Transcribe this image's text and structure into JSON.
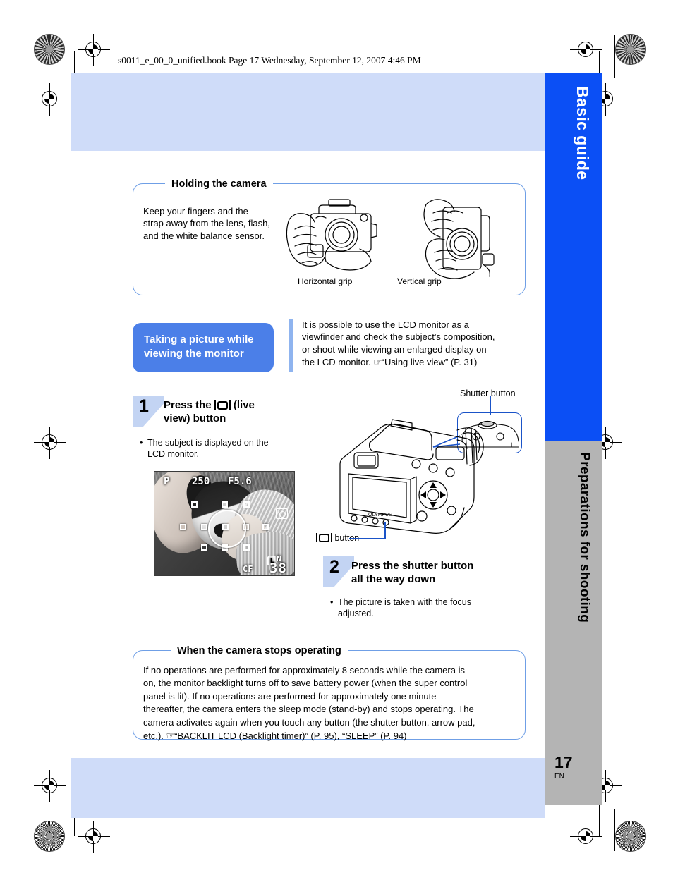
{
  "header": {
    "book_line": "s0011_e_00_0_unified.book  Page 17  Wednesday, September 12, 2007  4:46 PM"
  },
  "side_tabs": [
    {
      "label": "Basic guide",
      "color": "#0b4ff5",
      "text_color": "#ffffff"
    },
    {
      "label": "Preparations for shooting",
      "color": "#b4b4b4",
      "text_color": "#000000"
    }
  ],
  "page_footer": {
    "number": "17",
    "language": "EN"
  },
  "holding_panel": {
    "title": "Holding the camera",
    "body": "Keep your fingers and the strap away from the lens, flash, and the white balance sensor.",
    "caption_left": "Horizontal grip",
    "caption_right": "Vertical grip"
  },
  "section": {
    "callout_title": "Taking a picture while viewing the monitor",
    "intro_line1": "It is possible to use the LCD monitor as a",
    "intro_line2": "viewfinder and check the subject's composition,",
    "intro_line3": "or shoot while viewing an enlarged display on",
    "intro_line4_prefix": "the LCD monitor. ",
    "intro_line4_ref": "“Using live view” (P. 31)"
  },
  "steps": [
    {
      "number": "1",
      "title_line1_before": "Press the ",
      "title_line1_after": " (live",
      "title_line2": "view) button",
      "bullet_marker": "•",
      "bullet_line1": "The subject is displayed on the",
      "bullet_line2": "LCD monitor."
    },
    {
      "number": "2",
      "title_line1": "Press the shutter button",
      "title_line2": "all the way down",
      "bullet_marker": "•",
      "bullet_line1": "The picture is taken with the focus",
      "bullet_line2": "adjusted."
    }
  ],
  "lcd_display": {
    "mode": "P",
    "shutter_speed": "250",
    "aperture": "F5.6",
    "quality_size": "L",
    "quality_compression": "N",
    "card": "CF",
    "frames_remaining": "38",
    "metering_icon": "esp-metering-icon"
  },
  "camera_labels": {
    "shutter_button": "Shutter button",
    "live_view_button_suffix": " button"
  },
  "stops_panel": {
    "title": "When the camera stops operating",
    "line1": "If no operations are performed for approximately 8 seconds while the camera is",
    "line2": "on, the monitor backlight turns off to save battery power (when the super control",
    "line3": "panel is lit). If no operations are performed for approximately one minute",
    "line4": "thereafter, the camera enters the sleep mode (stand-by) and stops operating. The",
    "line5": "camera activates again when you touch any button (the shutter button, arrow pad,",
    "line6_prefix": "etc.). ",
    "line6_ref": "“BACKLIT LCD (Backlight timer)” (P. 95), “SLEEP” (P. 94)"
  },
  "colors": {
    "tint_band": "#cfdcf9",
    "tab_blue": "#0b4ff5",
    "tab_gray": "#b4b4b4",
    "panel_border": "#6f9fe6",
    "callout_bg": "#4b7fe8",
    "leader_blue": "#1a53c8",
    "step_flag": "#c3d4f3"
  }
}
